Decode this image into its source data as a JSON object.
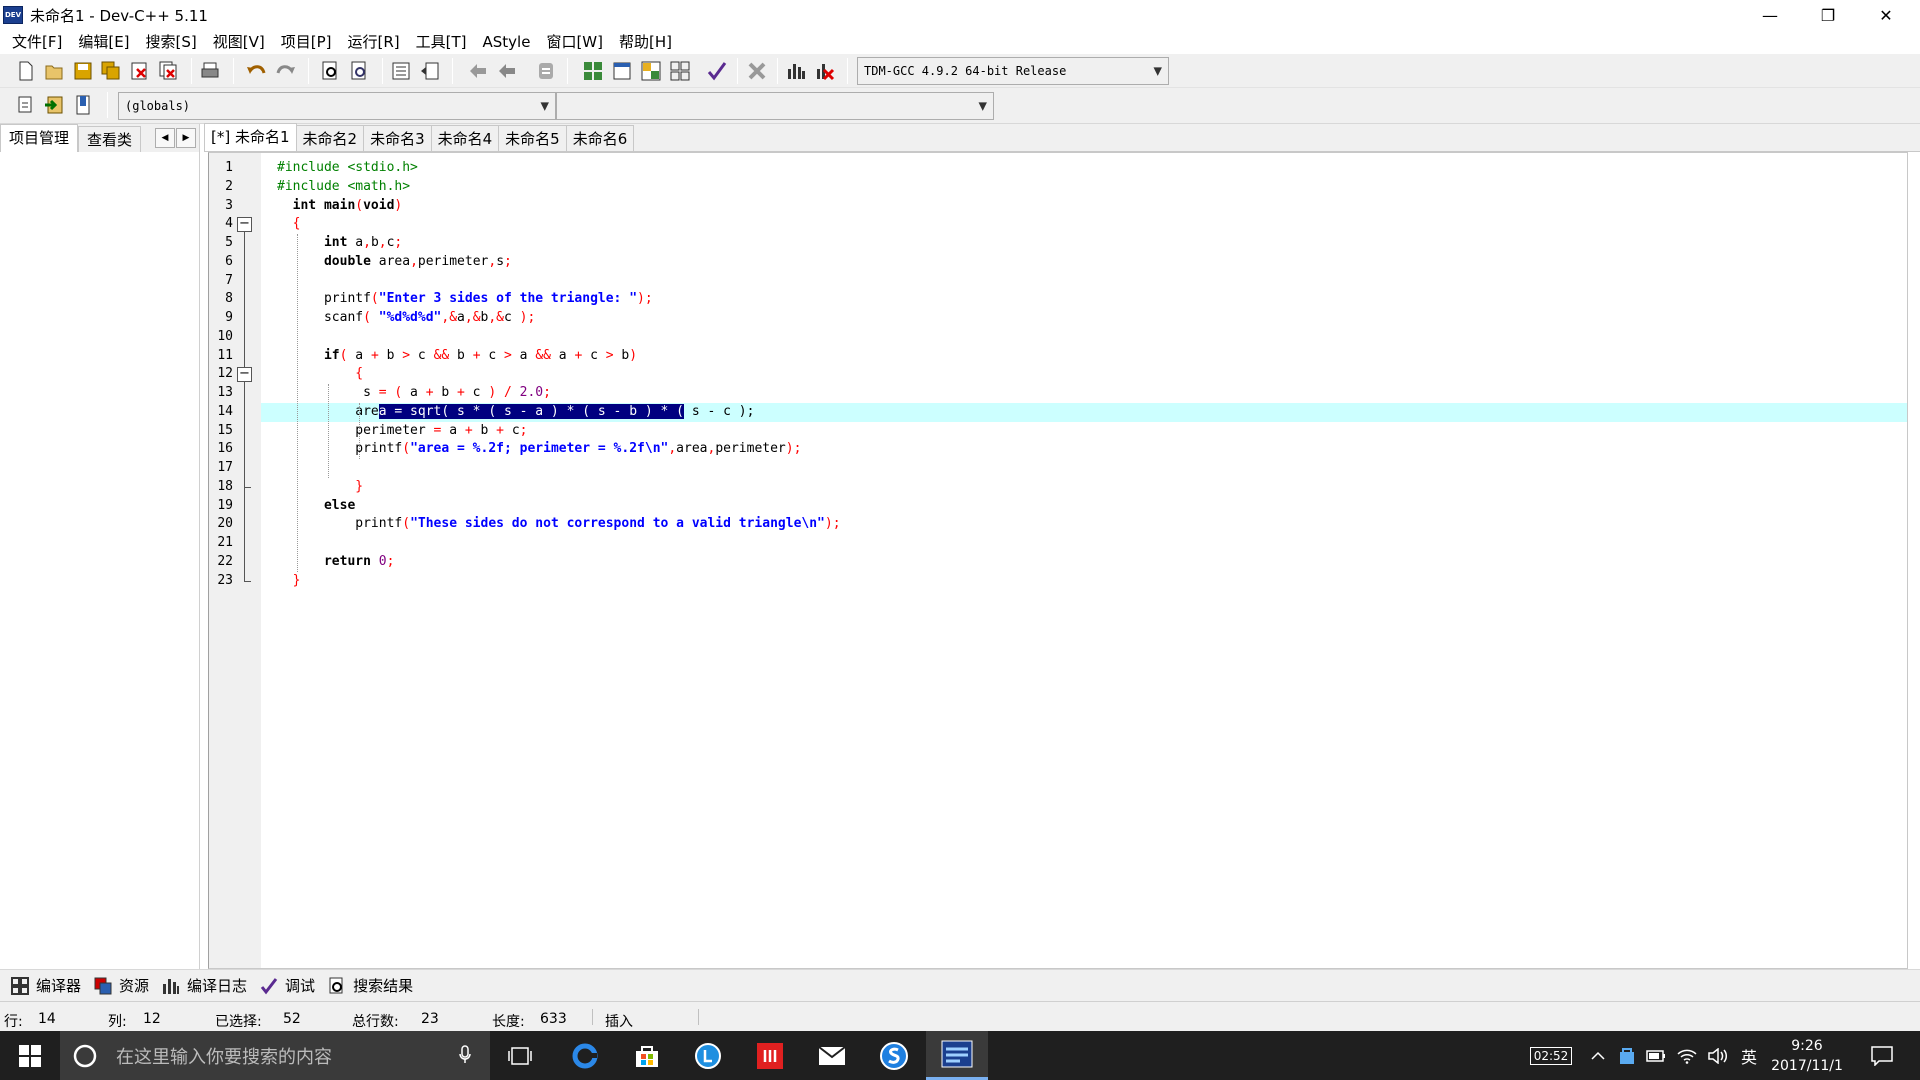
{
  "window": {
    "title": "未命名1 - Dev-C++ 5.11",
    "app_icon_text": "DEV",
    "minimize": "—",
    "restore": "❐",
    "close": "✕"
  },
  "menu": [
    "文件[F]",
    "编辑[E]",
    "搜索[S]",
    "视图[V]",
    "项目[P]",
    "运行[R]",
    "工具[T]",
    "AStyle",
    "窗口[W]",
    "帮助[H]"
  ],
  "toolbar": {
    "compiler_select": "TDM-GCC 4.9.2 64-bit Release",
    "scope_select": "(globals)",
    "function_select": ""
  },
  "left_tabs": [
    "项目管理",
    "查看类"
  ],
  "left_scroll": {
    "prev": "◀",
    "next": "▶"
  },
  "editor_tabs": [
    "[*] 未命名1",
    "未命名2",
    "未命名3",
    "未命名4",
    "未命名5",
    "未命名6"
  ],
  "gutter": {
    "collapse_glyph": "−"
  },
  "code_lines": [
    "#include <stdio.h>",
    "#include <math.h>",
    "int main(void)",
    "{",
    "int a,b,c;",
    "double area,perimeter,s;",
    "",
    "printf(\"Enter 3 sides of the triangle: \");",
    "scanf( \"%d%d%d\",&a,&b,&c );",
    "",
    "if( a + b > c && b + c > a && a + c > b)",
    "{",
    "s = ( a + b + c ) / 2.0;",
    "area = sqrt( s * ( s - a ) * ( s - b ) * ( s - c );",
    "perimeter = a + b + c;",
    "printf(\"area = %.2f; perimeter = %.2f\\n\",area,perimeter);",
    "",
    "}",
    "else",
    "printf(\"These sides do not correspond to a valid triangle\\n\");",
    "",
    "return 0;",
    "}"
  ],
  "bottom_tabs": [
    "编译器",
    "资源",
    "编译日志",
    "调试",
    "搜索结果"
  ],
  "status": {
    "row_label": "行:",
    "row": "14",
    "col_label": "列:",
    "col": "12",
    "sel_label": "已选择:",
    "sel": "52",
    "lines_label": "总行数:",
    "lines": "23",
    "len_label": "长度:",
    "len": "633",
    "mode": "插入"
  },
  "taskbar": {
    "search_placeholder": "在这里输入你要搜索的内容",
    "battery_time": "02:52",
    "ime": "英",
    "time": "9:26",
    "date": "2017/11/1"
  },
  "colors": {
    "keyword": "#000000",
    "preprocessor": "#008000",
    "string": "#0000ff",
    "operator": "#ff0000",
    "number": "#800080",
    "current_line": "#ccffff",
    "selection": "#000080"
  }
}
